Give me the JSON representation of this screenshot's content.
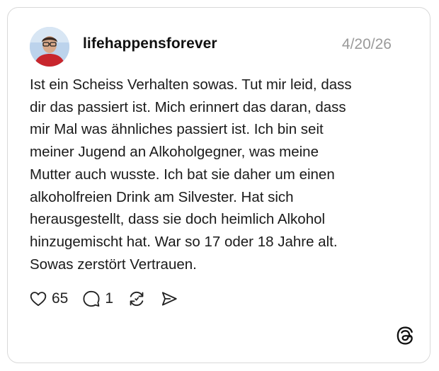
{
  "post": {
    "username": "lifehappensforever",
    "timestamp": "4/20/26",
    "text": "Ist ein Scheiss Verhalten sowas. Tut mir leid, dass\ndir das passiert ist. Mich erinnert das daran, dass\nmir Mal was ähnliches passiert ist. Ich bin seit\nmeiner Jugend an Alkoholgegner, was meine\nMutter auch wusste. Ich bat sie daher um einen\nalkoholfreien Drink am Silvester. Hat sich\nherausgestellt, dass sie doch heimlich Alkohol\nhinzugemischt hat. War so 17 oder 18 Jahre alt.\nSowas zerstört Vertrauen."
  },
  "actions": {
    "likes": "65",
    "replies": "1"
  },
  "icons": {
    "like": "heart-icon",
    "reply": "speech-bubble-icon",
    "repost": "repost-icon",
    "share": "send-icon",
    "brand": "threads-logo-icon"
  },
  "colors": {
    "border": "#d9d9d9",
    "text": "#1a1a1a",
    "muted": "#9a9a9a"
  }
}
